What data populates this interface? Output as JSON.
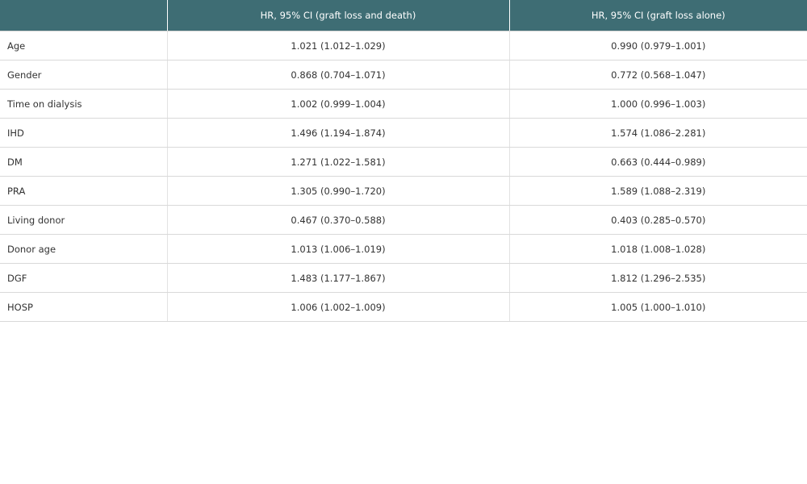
{
  "table": {
    "headers": [
      "",
      "HR, 95% CI (graft loss and death)",
      "HR, 95% CI (graft loss alone)"
    ],
    "rows": [
      [
        "Age",
        "1.021 (1.012–1.029)",
        "0.990 (0.979–1.001)"
      ],
      [
        "Gender",
        "0.868 (0.704–1.071)",
        "0.772 (0.568–1.047)"
      ],
      [
        "Time on dialysis",
        "1.002 (0.999–1.004)",
        "1.000 (0.996–1.003)"
      ],
      [
        "IHD",
        "1.496 (1.194–1.874)",
        "1.574 (1.086–2.281)"
      ],
      [
        "DM",
        "1.271 (1.022–1.581)",
        "0.663 (0.444–0.989)"
      ],
      [
        "PRA",
        "1.305 (0.990–1.720)",
        "1.589 (1.088–2.319)"
      ],
      [
        "Living donor",
        "0.467 (0.370–0.588)",
        "0.403 (0.285–0.570)"
      ],
      [
        "Donor age",
        "1.013 (1.006–1.019)",
        "1.018 (1.008–1.028)"
      ],
      [
        "DGF",
        "1.483 (1.177–1.867)",
        "1.812 (1.296–2.535)"
      ],
      [
        "HOSP",
        "1.006 (1.002–1.009)",
        "1.005 (1.000–1.010)"
      ]
    ]
  },
  "colors": {
    "header_background": "#3e6d74",
    "header_text": "#ffffff",
    "body_text": "#333333",
    "row_divider": "#d9d9d9"
  }
}
